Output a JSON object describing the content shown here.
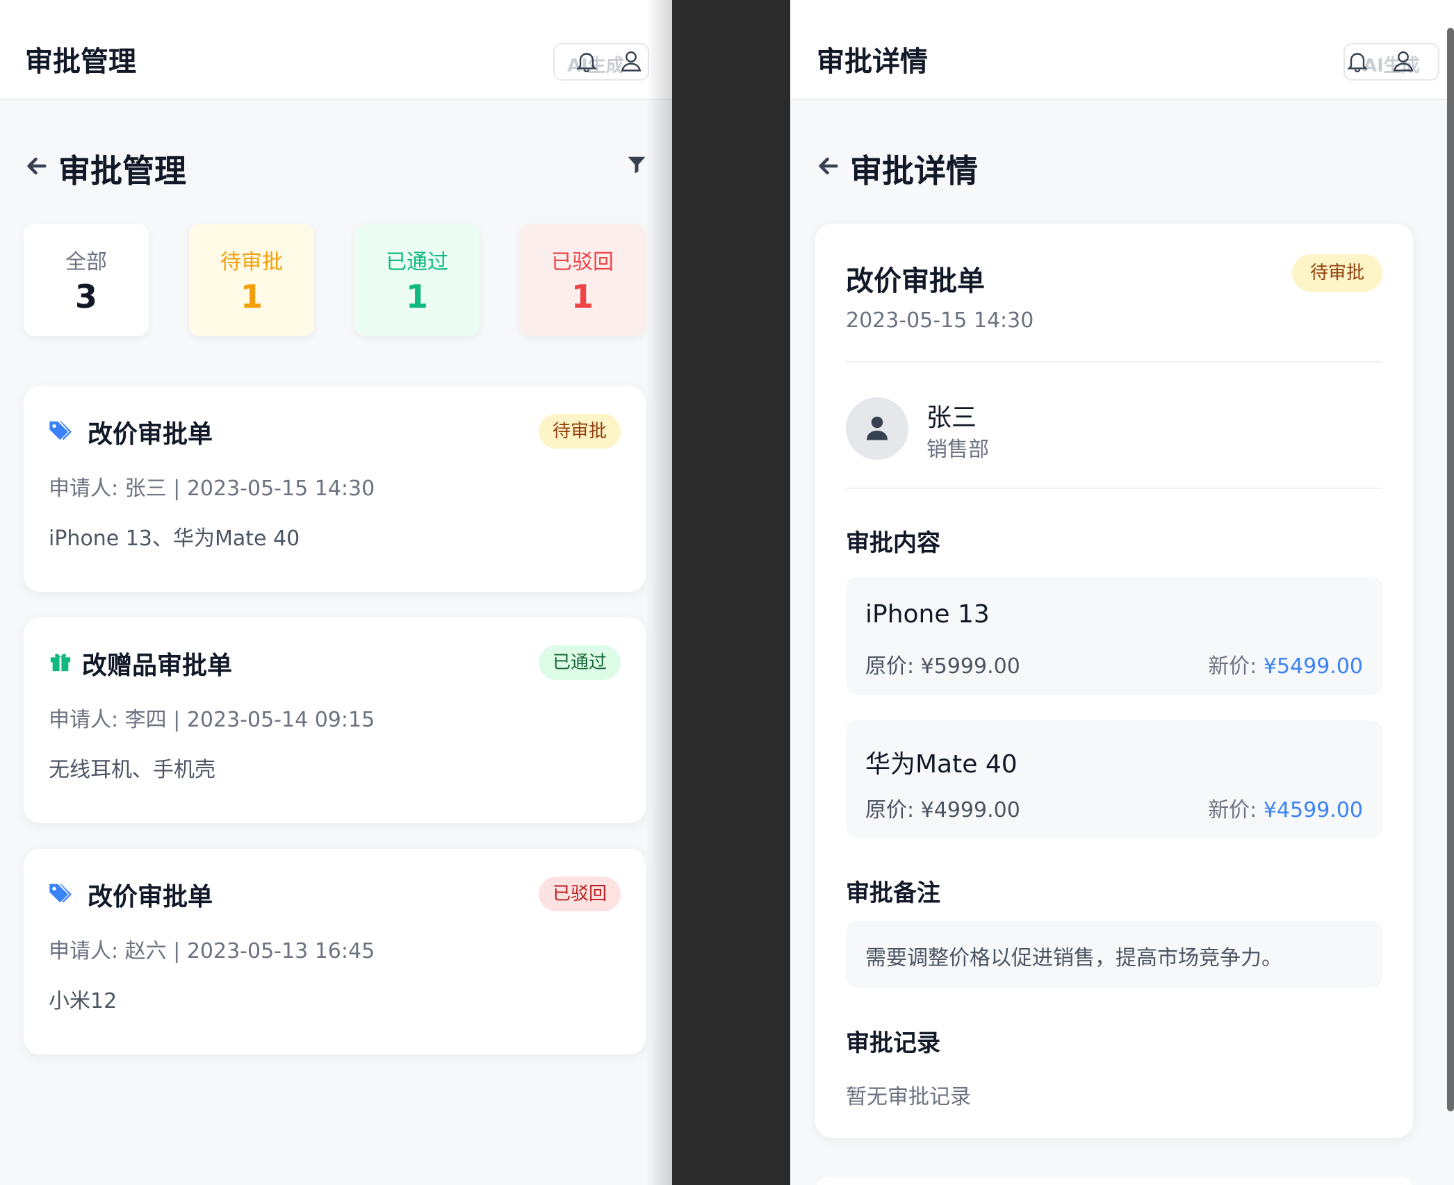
{
  "left": {
    "topbar": {
      "title": "审批管理",
      "ai_label": "AI生成"
    },
    "header": {
      "title": "审批管理"
    },
    "stats": [
      {
        "label": "全部",
        "count": "3",
        "bg": "#ffffff",
        "label_color": "#6b7280",
        "count_color": "#111827"
      },
      {
        "label": "待审批",
        "count": "1",
        "bg": "#fffbe6",
        "label_color": "#f59e0b",
        "count_color": "#f59e0b"
      },
      {
        "label": "已通过",
        "count": "1",
        "bg": "#ecfdf3",
        "label_color": "#10b981",
        "count_color": "#10b981"
      },
      {
        "label": "已驳回",
        "count": "1",
        "bg": "#fdeeee",
        "label_color": "#ef4444",
        "count_color": "#ef4444"
      }
    ],
    "cards": [
      {
        "icon": "tag-icon",
        "title": "改价审批单",
        "status": "待审批",
        "meta": "申请人: 张三 | 2023-05-15 14:30",
        "items": "iPhone 13、华为Mate 40"
      },
      {
        "icon": "gift-icon",
        "title": "改赠品审批单",
        "status": "已通过",
        "meta": "申请人: 李四 | 2023-05-14 09:15",
        "items": "无线耳机、手机壳"
      },
      {
        "icon": "tag-icon",
        "title": "改价审批单",
        "status": "已驳回",
        "meta": "申请人: 赵六 | 2023-05-13 16:45",
        "items": "小米12"
      }
    ]
  },
  "right": {
    "topbar": {
      "title": "审批详情",
      "ai_label": "AI生成"
    },
    "header": {
      "title": "审批详情"
    },
    "detail": {
      "title": "改价审批单",
      "status": "待审批",
      "date": "2023-05-15 14:30",
      "applicant": {
        "name": "张三",
        "dept": "销售部"
      },
      "content_title": "审批内容",
      "items": [
        {
          "name": "iPhone 13",
          "orig_label": "原价: ",
          "orig": "¥5999.00",
          "new_label": "新价: ",
          "new": "¥5499.00"
        },
        {
          "name": "华为Mate 40",
          "orig_label": "原价: ",
          "orig": "¥4999.00",
          "new_label": "新价: ",
          "new": "¥4599.00"
        }
      ],
      "remark_title": "审批备注",
      "remark": "需要调整价格以促进销售，提高市场竞争力。",
      "records_title": "审批记录",
      "records_empty": "暂无审批记录"
    }
  },
  "colors": {
    "pending_bg": "#fdf4c7",
    "pending_fg": "#92400e",
    "approved_bg": "#dcfce7",
    "approved_fg": "#166534",
    "rejected_bg": "#fde2e2",
    "rejected_fg": "#b91c1c",
    "accent_blue": "#3b82f6",
    "gift_green": "#10b981"
  }
}
